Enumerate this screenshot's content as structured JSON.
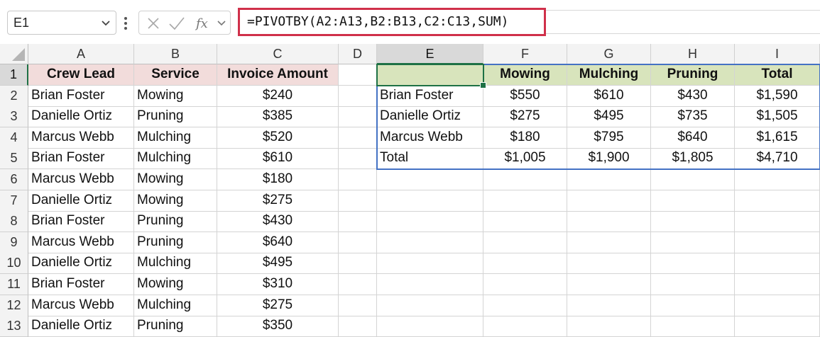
{
  "formula_bar": {
    "name_box": "E1",
    "formula": "=PIVOTBY(A2:A13,B2:B13,C2:C13,SUM)",
    "cancel_icon": "x-icon",
    "enter_icon": "check-icon",
    "function_icon": "fx-icon"
  },
  "columns": [
    "A",
    "B",
    "C",
    "D",
    "E",
    "F",
    "G",
    "H",
    "I"
  ],
  "rows": [
    "1",
    "2",
    "3",
    "4",
    "5",
    "6",
    "7",
    "8",
    "9",
    "10",
    "11",
    "12",
    "13"
  ],
  "source": {
    "headers": [
      "Crew Lead",
      "Service",
      "Invoice Amount"
    ],
    "data": [
      [
        "Brian Foster",
        "Mowing",
        "$240"
      ],
      [
        "Danielle Ortiz",
        "Pruning",
        "$385"
      ],
      [
        "Marcus Webb",
        "Mulching",
        "$520"
      ],
      [
        "Brian Foster",
        "Mulching",
        "$610"
      ],
      [
        "Marcus Webb",
        "Mowing",
        "$180"
      ],
      [
        "Danielle Ortiz",
        "Mowing",
        "$275"
      ],
      [
        "Brian Foster",
        "Pruning",
        "$430"
      ],
      [
        "Marcus Webb",
        "Pruning",
        "$640"
      ],
      [
        "Danielle Ortiz",
        "Mulching",
        "$495"
      ],
      [
        "Brian Foster",
        "Mowing",
        "$310"
      ],
      [
        "Marcus Webb",
        "Mulching",
        "$275"
      ],
      [
        "Danielle Ortiz",
        "Pruning",
        "$350"
      ]
    ]
  },
  "pivot": {
    "headers": [
      "",
      "Mowing",
      "Mulching",
      "Pruning",
      "Total"
    ],
    "rows": [
      [
        "Brian Foster",
        "$550",
        "$610",
        "$430",
        "$1,590"
      ],
      [
        "Danielle Ortiz",
        "$275",
        "$495",
        "$735",
        "$1,505"
      ],
      [
        "Marcus Webb",
        "$180",
        "$795",
        "$640",
        "$1,615"
      ],
      [
        "Total",
        "$1,005",
        "$1,900",
        "$1,805",
        "$4,710"
      ]
    ]
  },
  "colors": {
    "source_header_bg": "#f2dcdb",
    "pivot_header_bg": "#d8e4bc",
    "pivot_border": "#4472c4",
    "formula_highlight": "#d0304a",
    "selection": "#1e7145"
  }
}
